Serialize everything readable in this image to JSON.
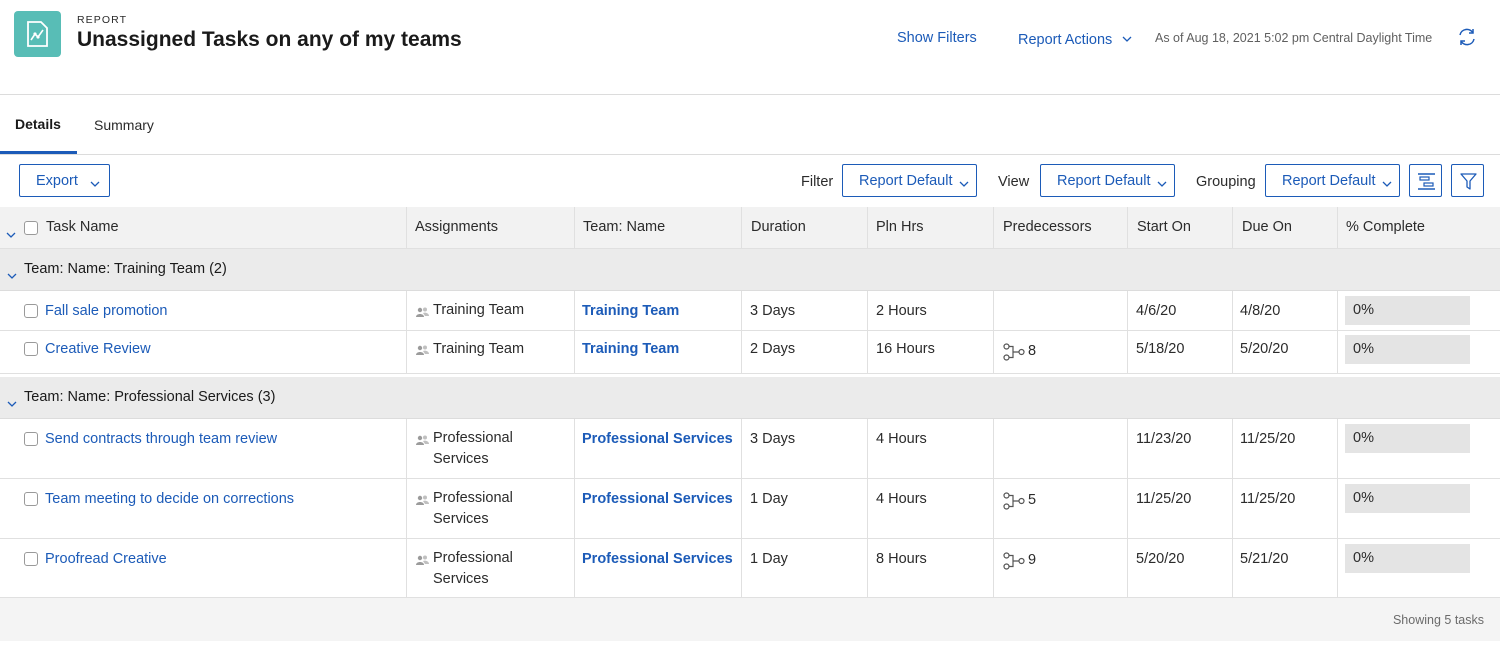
{
  "header": {
    "eyebrow": "REPORT",
    "title": "Unassigned Tasks on any of my teams",
    "show_filters": "Show Filters",
    "report_actions": "Report Actions",
    "as_of": "As of Aug 18, 2021 5:02 pm Central Daylight Time",
    "icons": {
      "report": "report-chart-icon",
      "refresh": "refresh-icon"
    }
  },
  "tabs": [
    {
      "label": "Details",
      "active": true
    },
    {
      "label": "Summary",
      "active": false
    }
  ],
  "toolbar": {
    "export_label": "Export",
    "filter_label": "Filter",
    "filter_value": "Report Default",
    "view_label": "View",
    "view_value": "Report Default",
    "grouping_label": "Grouping",
    "grouping_value": "Report Default",
    "icons": {
      "gantt": "gantt-icon",
      "funnel": "funnel-icon"
    }
  },
  "table": {
    "columns": [
      "Task Name",
      "Assignments",
      "Team: Name",
      "Duration",
      "Pln Hrs",
      "Predecessors",
      "Start On",
      "Due On",
      "% Complete"
    ],
    "groups": [
      {
        "label": "Team: Name: Training Team (2)",
        "rows": [
          {
            "task": "Fall sale promotion",
            "assign": [
              "Training Team"
            ],
            "team": "Training Team",
            "duration": "3 Days",
            "pln": "2 Hours",
            "pred": "",
            "start": "4/6/20",
            "due": "4/8/20",
            "pct": "0%"
          },
          {
            "task": "Creative Review",
            "assign": [
              "Training Team"
            ],
            "team": "Training Team",
            "duration": "2 Days",
            "pln": "16 Hours",
            "pred": "8",
            "start": "5/18/20",
            "due": "5/20/20",
            "pct": "0%"
          }
        ]
      },
      {
        "label": "Team: Name: Professional Services (3)",
        "rows": [
          {
            "task": "Send contracts through team review",
            "assign": [
              "Professional",
              "Services"
            ],
            "team": "Professional Services",
            "duration": "3 Days",
            "pln": "4 Hours",
            "pred": "",
            "start": "11/23/20",
            "due": "11/25/20",
            "pct": "0%"
          },
          {
            "task": "Team meeting to decide on corrections",
            "assign": [
              "Professional",
              "Services"
            ],
            "team": "Professional Services",
            "duration": "1 Day",
            "pln": "4 Hours",
            "pred": "5",
            "start": "11/25/20",
            "due": "11/25/20",
            "pct": "0%"
          },
          {
            "task": "Proofread Creative",
            "assign": [
              "Professional",
              "Services"
            ],
            "team": "Professional Services",
            "duration": "1 Day",
            "pln": "8 Hours",
            "pred": "9",
            "start": "5/20/20",
            "due": "5/21/20",
            "pct": "0%"
          }
        ]
      }
    ],
    "footer": "Showing 5 tasks"
  },
  "colors": {
    "link": "#1c5bb8",
    "icon_teal": "#58bdb6",
    "group_bg": "#ebebeb",
    "header_bg": "#f2f2f2"
  }
}
